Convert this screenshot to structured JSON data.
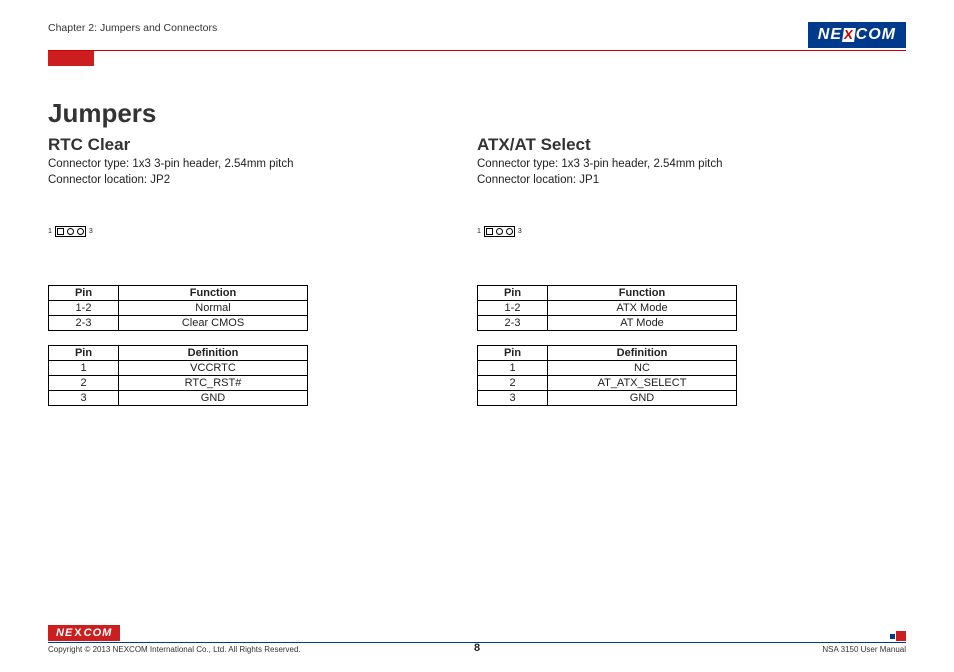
{
  "header": {
    "chapter": "Chapter 2: Jumpers and Connectors",
    "logo_parts": {
      "pre": "NE",
      "x": "X",
      "post": "COM"
    }
  },
  "main_heading": "Jumpers",
  "sections": [
    {
      "title": "RTC Clear",
      "connector_type": "Connector type: 1x3 3-pin header, 2.54mm pitch",
      "connector_location": "Connector location: JP2",
      "diagram": {
        "left_pin": "1",
        "right_pin": "3"
      },
      "function_table": {
        "headers": [
          "Pin",
          "Function"
        ],
        "rows": [
          [
            "1-2",
            "Normal"
          ],
          [
            "2-3",
            "Clear CMOS"
          ]
        ]
      },
      "definition_table": {
        "headers": [
          "Pin",
          "Definition"
        ],
        "rows": [
          [
            "1",
            "VCCRTC"
          ],
          [
            "2",
            "RTC_RST#"
          ],
          [
            "3",
            "GND"
          ]
        ]
      }
    },
    {
      "title": "ATX/AT Select",
      "connector_type": "Connector type: 1x3 3-pin header, 2.54mm pitch",
      "connector_location": "Connector location: JP1",
      "diagram": {
        "left_pin": "1",
        "right_pin": "3"
      },
      "function_table": {
        "headers": [
          "Pin",
          "Function"
        ],
        "rows": [
          [
            "1-2",
            "ATX Mode"
          ],
          [
            "2-3",
            "AT Mode"
          ]
        ]
      },
      "definition_table": {
        "headers": [
          "Pin",
          "Definition"
        ],
        "rows": [
          [
            "1",
            "NC"
          ],
          [
            "2",
            "AT_ATX_SELECT"
          ],
          [
            "3",
            "GND"
          ]
        ]
      }
    }
  ],
  "footer": {
    "logo_parts": {
      "pre": "NE",
      "x": "X",
      "post": "COM"
    },
    "copyright": "Copyright © 2013 NEXCOM International Co., Ltd. All Rights Reserved.",
    "page_number": "8",
    "manual": "NSA 3150 User Manual"
  }
}
